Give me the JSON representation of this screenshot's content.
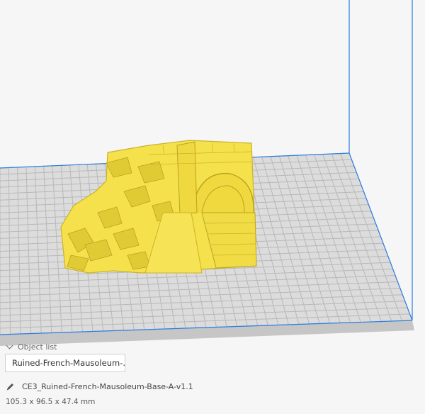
{
  "object_list": {
    "toggle_label": "Object list",
    "items": [
      "Ruined-French-Mausoleum-..."
    ]
  },
  "selected_object": {
    "file_name": "CE3_Ruined-French-Mausoleum-Base-A-v1.1",
    "dimensions": "105.3 x 96.5 x 47.4 mm"
  },
  "icons": {
    "object_list_toggle": "chevron-down-icon",
    "file_name": "pencil-icon"
  },
  "colors": {
    "build_plate": "#dcdcdc",
    "grid_lines": "#b8b8b8",
    "build_volume_outline": "#2d7de0",
    "model": "#f5e14c",
    "model_shadow": "#c9b428",
    "background": "#f6f6f6"
  }
}
